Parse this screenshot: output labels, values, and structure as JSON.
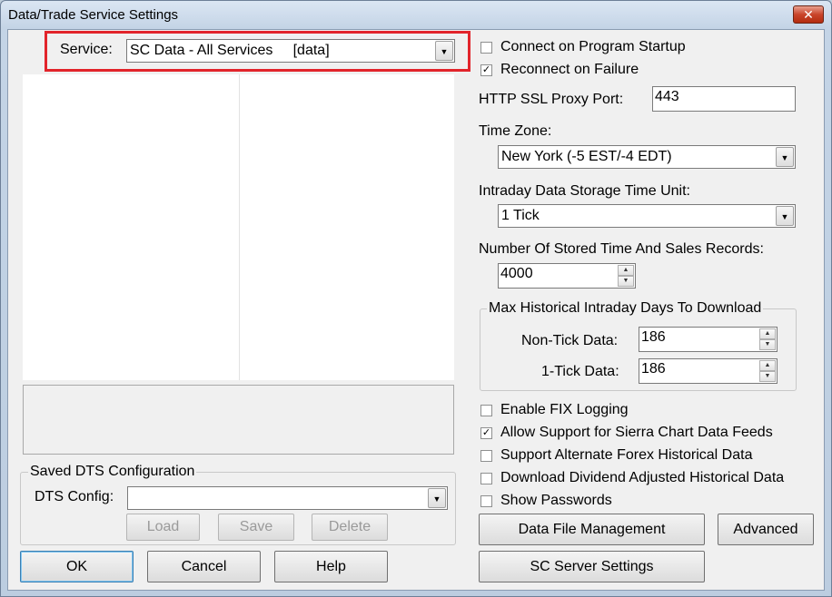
{
  "window": {
    "title": "Data/Trade Service Settings",
    "close_glyph": "✕"
  },
  "service": {
    "label": "Service:",
    "value": "SC Data - All Services     [data]",
    "highlight_color": "#e2242b"
  },
  "saved_dts": {
    "group_title": "Saved DTS Configuration",
    "config_label": "DTS Config:",
    "config_value": "",
    "load_label": "Load",
    "save_label": "Save",
    "delete_label": "Delete"
  },
  "bottom_buttons": {
    "ok": "OK",
    "cancel": "Cancel",
    "help": "Help"
  },
  "options": {
    "connect_on_startup": {
      "label": "Connect on Program Startup",
      "checked": false
    },
    "reconnect_on_failure": {
      "label": "Reconnect on Failure",
      "checked": true
    },
    "http_ssl_proxy_port_label": "HTTP SSL Proxy Port:",
    "http_ssl_proxy_port_value": "443",
    "time_zone_label": "Time Zone:",
    "time_zone_value": "New York (-5 EST/-4 EDT)",
    "intraday_storage_label": "Intraday Data Storage Time Unit:",
    "intraday_storage_value": "1 Tick",
    "stored_records_label": "Number Of Stored Time And Sales Records:",
    "stored_records_value": "4000"
  },
  "historical": {
    "group_title": "Max Historical Intraday Days To Download",
    "non_tick_label": "Non-Tick Data:",
    "non_tick_value": "186",
    "one_tick_label": "1-Tick Data:",
    "one_tick_value": "186"
  },
  "flags": {
    "enable_fix_logging": {
      "label": "Enable FIX Logging",
      "checked": false
    },
    "allow_sierra_feeds": {
      "label": "Allow Support for Sierra Chart Data Feeds",
      "checked": true
    },
    "alt_forex": {
      "label": "Support Alternate Forex Historical Data",
      "checked": false
    },
    "dividend_adjusted": {
      "label": "Download Dividend Adjusted Historical Data",
      "checked": false
    },
    "show_passwords": {
      "label": "Show Passwords",
      "checked": false
    }
  },
  "action_buttons": {
    "data_file_management": "Data File Management",
    "advanced": "Advanced",
    "sc_server_settings": "SC Server Settings"
  },
  "icons": {
    "dropdown": "▼",
    "spin_up": "▲",
    "spin_down": "▼",
    "check": "✓"
  }
}
